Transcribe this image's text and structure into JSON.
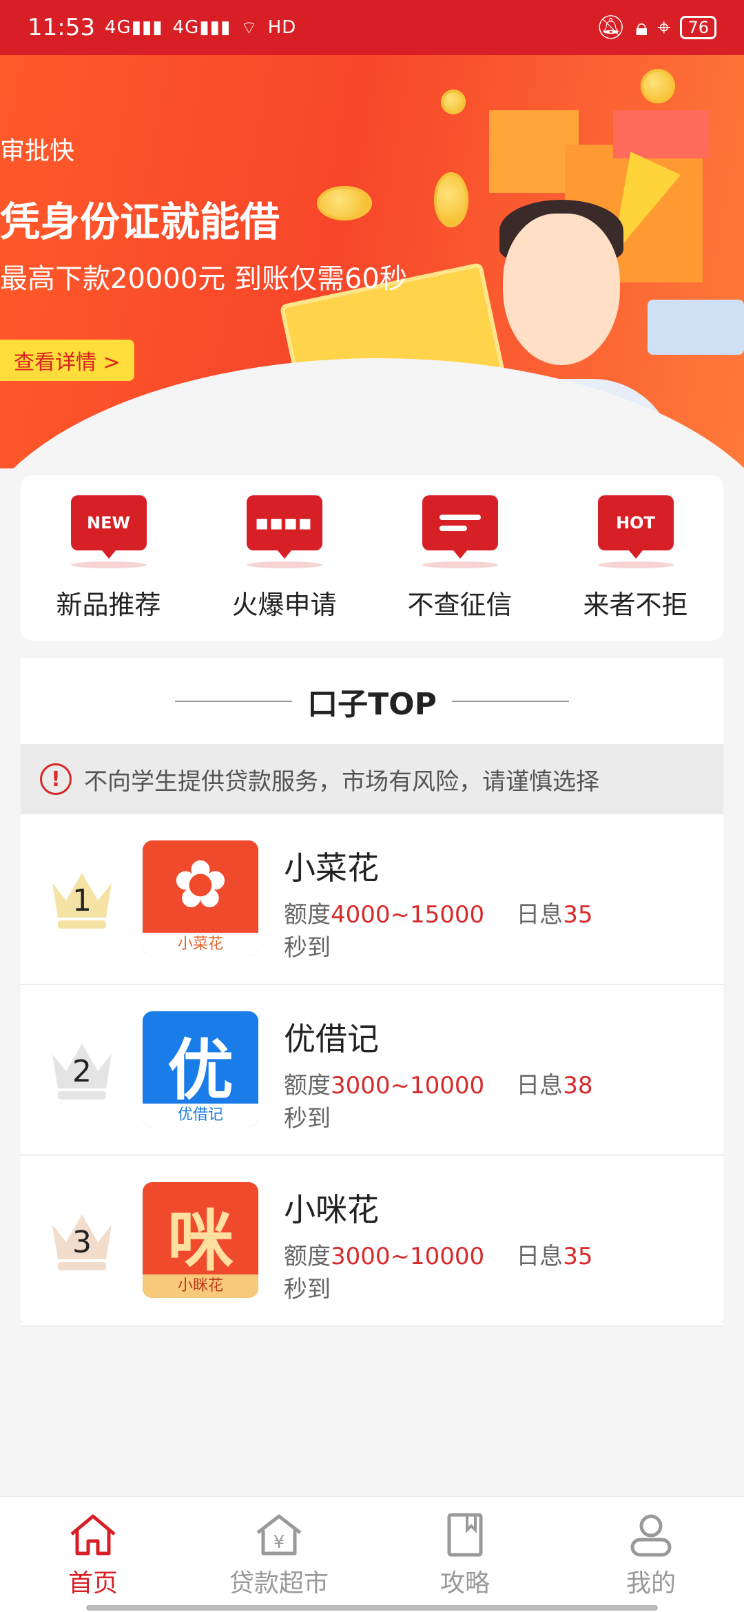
{
  "status_bar": {
    "time": "11:53",
    "signal1": "4G",
    "signal2": "4G",
    "hd": "HD",
    "battery": "76"
  },
  "banner": {
    "tagline": "审批快",
    "title": "凭身份证就能借",
    "subtitle": "最高下款20000元 到账仅需60秒",
    "button": "查看详情 >"
  },
  "categories": [
    {
      "label": "新品推荐",
      "icon_text": "NEW",
      "icon": "new-badge-icon"
    },
    {
      "label": "火爆申请",
      "icon_text": "",
      "icon": "dots-badge-icon"
    },
    {
      "label": "不查征信",
      "icon_text": "",
      "icon": "lines-badge-icon"
    },
    {
      "label": "来者不拒",
      "icon_text": "HOT",
      "icon": "hot-badge-icon"
    }
  ],
  "top_list": {
    "title": "口子TOP",
    "notice": "不向学生提供贷款服务，市场有风险，请谨慎选择",
    "items": [
      {
        "rank": "1",
        "name": "小菜花",
        "amount_label": "额度",
        "amount": "4000~15000",
        "rate_label": "日息",
        "rate": "35",
        "speed": "秒到",
        "logo_caption": "小菜花",
        "logo_glyph": "✿",
        "logo_color": "#f04a2c",
        "crown_color": "#f5e3a6"
      },
      {
        "rank": "2",
        "name": "优借记",
        "amount_label": "额度",
        "amount": "3000~10000",
        "rate_label": "日息",
        "rate": "38",
        "speed": "秒到",
        "logo_caption": "优借记",
        "logo_glyph": "优",
        "logo_color": "#1a7ce8",
        "crown_color": "#e4e4e4"
      },
      {
        "rank": "3",
        "name": "小咪花",
        "amount_label": "额度",
        "amount": "3000~10000",
        "rate_label": "日息",
        "rate": "35",
        "speed": "秒到",
        "logo_caption": "小眯花",
        "logo_glyph": "咪",
        "logo_color": "#f04a2c",
        "crown_color": "#f2dccb"
      }
    ]
  },
  "bottom_nav": [
    {
      "label": "首页",
      "icon": "home-icon",
      "active": true
    },
    {
      "label": "贷款超市",
      "icon": "loan-market-icon",
      "active": false
    },
    {
      "label": "攻略",
      "icon": "guide-book-icon",
      "active": false
    },
    {
      "label": "我的",
      "icon": "profile-icon",
      "active": false
    }
  ],
  "colors": {
    "primary": "#d71f26",
    "accent_red": "#d72a2a"
  }
}
